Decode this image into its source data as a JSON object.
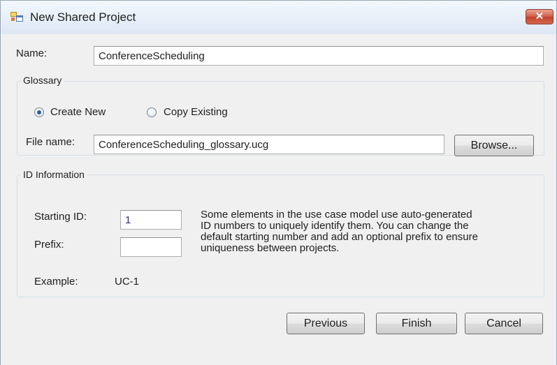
{
  "window": {
    "title": "New Shared Project",
    "close_symbol": "✕"
  },
  "name_field": {
    "label": "Name:",
    "value": "ConferenceScheduling"
  },
  "glossary": {
    "title": "Glossary",
    "options": [
      {
        "label": "Create New",
        "selected": true
      },
      {
        "label": "Copy Existing",
        "selected": false
      }
    ],
    "file_label": "File name:",
    "file_value": "ConferenceScheduling_glossary.ucg",
    "browse_label": "Browse..."
  },
  "id_info": {
    "title": "ID Information",
    "starting_id_label": "Starting ID:",
    "starting_id_value": "1",
    "prefix_label": "Prefix:",
    "prefix_value": "",
    "example_label": "Example:",
    "example_value": "UC-1",
    "description_lines": [
      "Some elements in the use case model use auto-generated",
      "ID numbers to uniquely identify them. You can change the",
      "default starting number and add an optional prefix to ensure",
      "uniqueness between projects."
    ]
  },
  "buttons": {
    "previous": "Previous",
    "finish": "Finish",
    "cancel": "Cancel"
  },
  "icons": {
    "app": "app-window-icon",
    "close": "close-icon"
  },
  "colors": {
    "window_bg": "#f0f0f0",
    "close_button": "#c2412c",
    "radio_dot": "#2a5d9a",
    "starting_id_text": "#3a2a7a"
  }
}
